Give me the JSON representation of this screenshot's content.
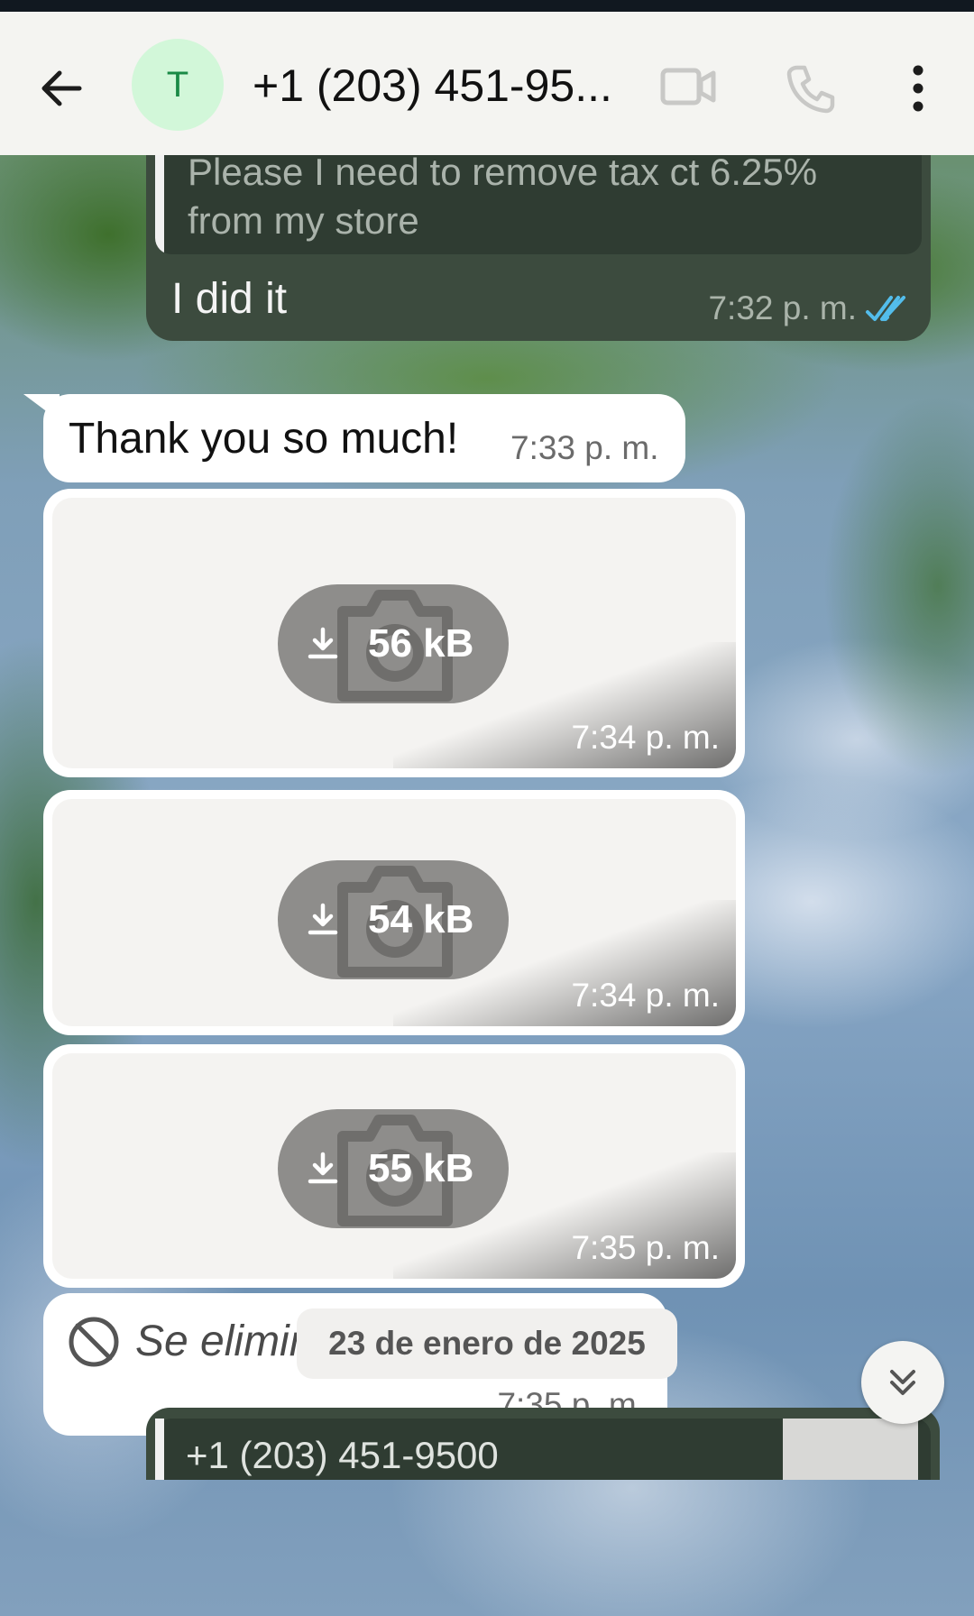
{
  "header": {
    "avatar_initial": "T",
    "contact_name": "+1 (203) 451-95...",
    "icons": [
      "back-arrow-icon",
      "video-call-icon",
      "phone-call-icon",
      "more-options-icon"
    ]
  },
  "messages": {
    "outgoing_reply": {
      "quoted_text": "Please I need to remove tax ct 6.25% from my store",
      "text": "I did it",
      "time": "7:32 p. m.",
      "status": "read"
    },
    "incoming_text": {
      "text": "Thank you so much!",
      "time": "7:33 p. m."
    },
    "images": [
      {
        "size": "56 kB",
        "time": "7:34 p. m."
      },
      {
        "size": "54 kB",
        "time": "7:34 p. m."
      },
      {
        "size": "55 kB",
        "time": "7:35 p. m."
      }
    ],
    "deleted": {
      "text": "Se eliminó este mensaje.",
      "time": "7:35 p. m."
    }
  },
  "date_separator": "23 de enero de 2025",
  "bottom_partial": {
    "quoted_sender": "+1 (203) 451-9500"
  },
  "colors": {
    "header_bg": "#f4f4f1",
    "outgoing_bubble": "#3c4b3e",
    "incoming_bubble": "#ffffff",
    "avatar_bg": "#d2f7d9",
    "avatar_text": "#1a8a46",
    "read_tick": "#53bdeb"
  }
}
